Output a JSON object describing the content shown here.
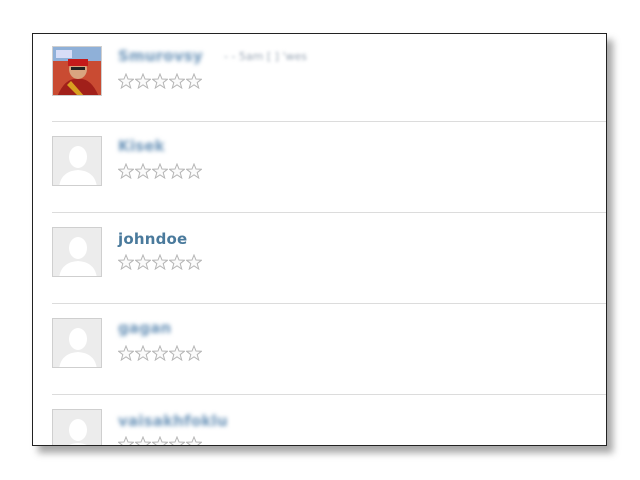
{
  "users": [
    {
      "name": "Smurovsy",
      "subtext": "- - 5am [ ] 'wes",
      "rating": 0,
      "avatar": "photo-avatar",
      "blurred": true
    },
    {
      "name": "Kisek",
      "subtext": "",
      "rating": 0,
      "avatar": "default-avatar",
      "blurred": true
    },
    {
      "name": "johndoe",
      "subtext": "",
      "rating": 0,
      "avatar": "default-avatar",
      "blurred": false
    },
    {
      "name": "gagan",
      "subtext": "",
      "rating": 0,
      "avatar": "default-avatar",
      "blurred": true
    },
    {
      "name": "vaisakhfoklu",
      "subtext": "",
      "rating": 0,
      "avatar": "default-avatar",
      "blurred": true
    }
  ],
  "max_stars": 5,
  "colors": {
    "username": "#4a7a9c",
    "separator": "#dcdcdc",
    "star_outline": "#b5b5b5"
  }
}
